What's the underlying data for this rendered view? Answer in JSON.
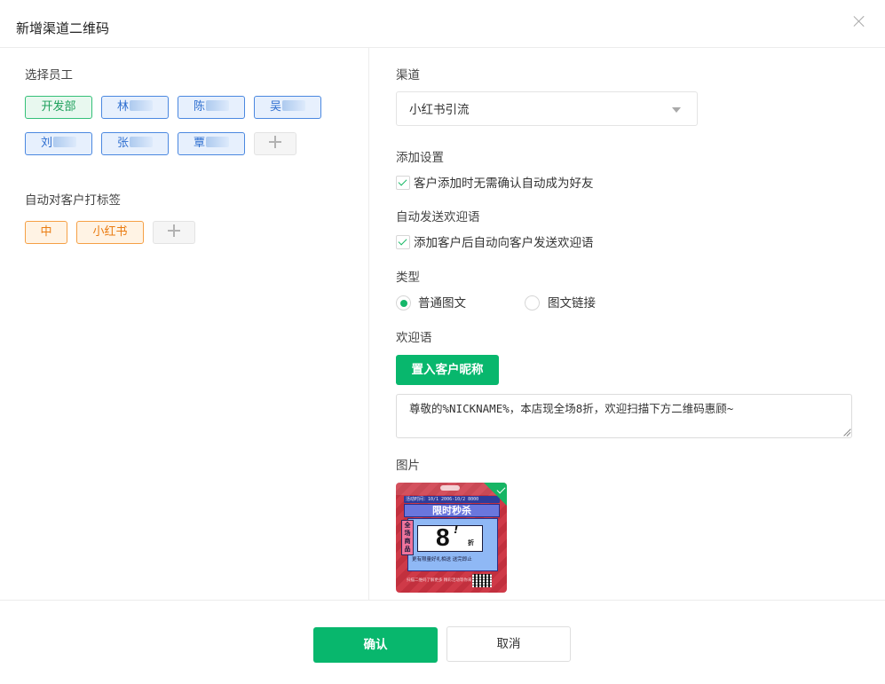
{
  "dialog": {
    "title": "新增渠道二维码",
    "close_icon": "close-icon"
  },
  "employees": {
    "label": "选择员工",
    "tags": [
      "开发部",
      "林",
      "陈",
      "吴",
      "刘",
      "张",
      "覃"
    ],
    "add_icon": "plus-icon"
  },
  "auto_tags": {
    "label": "自动对客户打标签",
    "tags": [
      "中",
      "小红书"
    ],
    "add_icon": "plus-icon"
  },
  "channel": {
    "label": "渠道",
    "selected": "小红书引流",
    "arrow_icon": "caret-down-icon"
  },
  "add_settings": {
    "label": "添加设置",
    "option": "客户添加时无需确认自动成为好友",
    "checked": true
  },
  "auto_welcome": {
    "label": "自动发送欢迎语",
    "option": "添加客户后自动向客户发送欢迎语",
    "checked": true
  },
  "type": {
    "label": "类型",
    "options": [
      "普通图文",
      "图文链接"
    ],
    "selected": "普通图文"
  },
  "welcome": {
    "label": "欢迎语",
    "insert_button": "置入客户昵称",
    "text": "尊敬的%NICKNAME%，本店现全场8折，欢迎扫描下方二维码惠顾~"
  },
  "image": {
    "label": "图片",
    "poster": {
      "date_line": "活动时间：10/1 2006-10/2 8000",
      "headline": "限时秒杀",
      "side_text": "全场商品",
      "discount": "8",
      "exclaim": "!",
      "discount_unit": "折",
      "gift_text": "更有限量好礼相送 送完即止",
      "footer_text": "扫描二维码了解更多 精彩活动等你来",
      "selected": true
    }
  },
  "footer": {
    "confirm": "确认",
    "cancel": "取消"
  },
  "colors": {
    "primary_green": "#08b76d",
    "tag_green": "#34c078",
    "tag_blue": "#4b88e0",
    "tag_orange": "#f5a045"
  }
}
